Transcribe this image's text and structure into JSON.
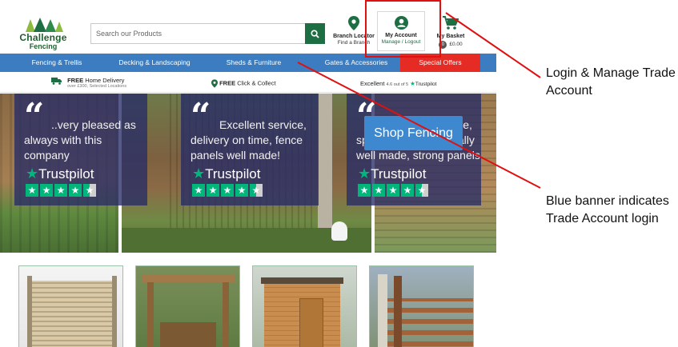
{
  "header": {
    "logo_name": "Challenge",
    "logo_sub": "Fencing",
    "search_placeholder": "Search our Products",
    "branch": {
      "title": "Branch Locator",
      "sub": "Find a Branch"
    },
    "account": {
      "title": "My Account",
      "sub": "Manage / Logout"
    },
    "basket": {
      "title": "My Basket",
      "sub": "£0.00",
      "count": "0"
    }
  },
  "nav": {
    "items": [
      {
        "label": "Fencing & Trellis"
      },
      {
        "label": "Decking & Landscaping"
      },
      {
        "label": "Sheds & Furniture"
      },
      {
        "label": "Gates & Accessories"
      },
      {
        "label": "Special Offers"
      }
    ],
    "bar_color": "#3b7dc0",
    "offers_color": "#e52b24"
  },
  "usp": {
    "delivery_bold": "FREE",
    "delivery_text": "Home Delivery",
    "delivery_small": "over £300, Selected Locations",
    "collect_bold": "FREE",
    "collect_text": "Click & Collect",
    "rating_label": "Excellent",
    "rating_text": "4.6 out of 5",
    "rating_brand": "Trustpilot"
  },
  "hero": {
    "quotes": [
      {
        "text": "..very pleased as always with this company"
      },
      {
        "text": "Excellent service, delivery on time, fence panels well made!"
      },
      {
        "text": "Excellent service, speedy delivery & really well made, strong panels"
      }
    ],
    "trustpilot_label": "Trustpilot",
    "cta": "Shop Fencing"
  },
  "annotations": {
    "login": "Login & Manage Trade Account",
    "banner": "Blue banner indicates Trade Account login",
    "color": "#e01010"
  }
}
